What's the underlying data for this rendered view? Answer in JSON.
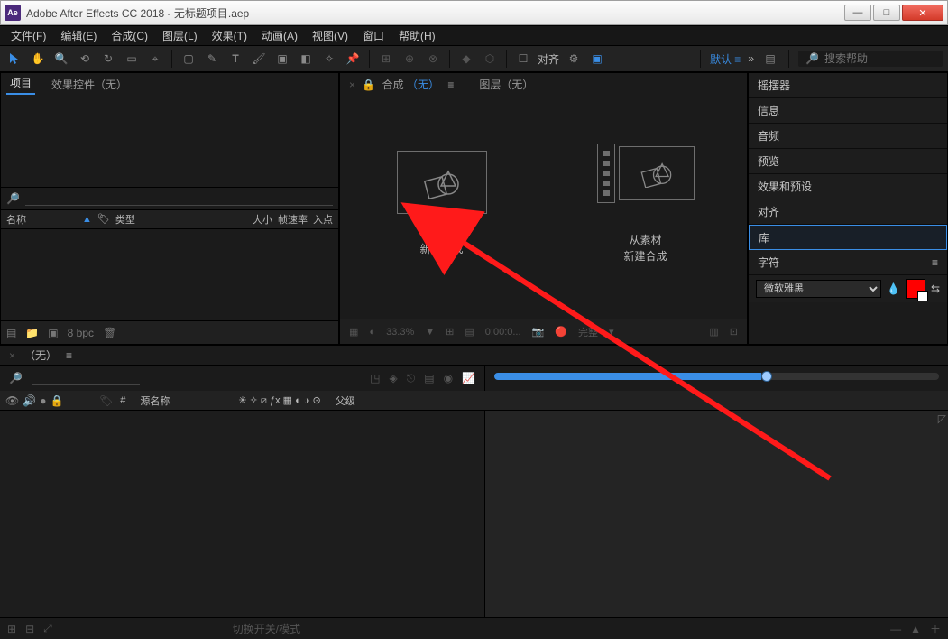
{
  "titlebar": {
    "app_icon": "Ae",
    "title": "Adobe After Effects CC 2018 - 无标题项目.aep"
  },
  "menu": {
    "file": "文件(F)",
    "edit": "编辑(E)",
    "composition": "合成(C)",
    "layer": "图层(L)",
    "effect": "效果(T)",
    "animation": "动画(A)",
    "view": "视图(V)",
    "window": "窗口",
    "help": "帮助(H)"
  },
  "toolrow": {
    "align_label": "对齐",
    "workspace_label": "默认",
    "search_placeholder": "搜索帮助"
  },
  "project": {
    "tab_project": "项目",
    "tab_effectcontrols": "效果控件（无）",
    "col_name": "名称",
    "col_type": "类型",
    "col_size": "大小",
    "col_fps": "帧速率",
    "col_in": "入点",
    "footer_bpc": "8 bpc"
  },
  "comp": {
    "tab_comp_prefix": "合成",
    "tab_comp_value": "（无）",
    "tab_layer": "图层（无）",
    "card_new": "新建合成",
    "card_from_line1": "从素材",
    "card_from_line2": "新建合成",
    "footer_zoom": "33.3%",
    "footer_time": "0:00:0...",
    "footer_quality": "完整"
  },
  "side": {
    "wiggler": "摇摆器",
    "info": "信息",
    "audio": "音频",
    "preview": "预览",
    "effects_presets": "效果和预设",
    "align": "对齐",
    "library": "库",
    "character": "字符",
    "font": "微软雅黑"
  },
  "timeline": {
    "tab_none": "（无）",
    "col_src": "源名称",
    "col_parent": "父级",
    "footer_toggle": "切换开关/模式",
    "layer_row_label": "#"
  }
}
